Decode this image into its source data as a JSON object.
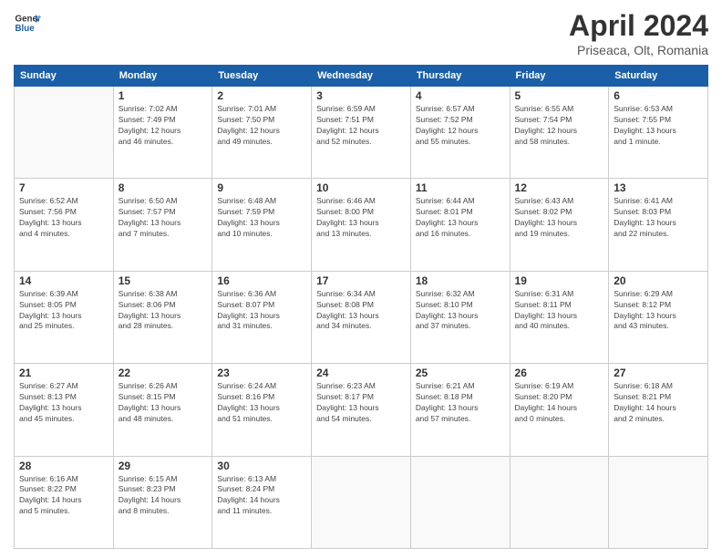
{
  "header": {
    "logo_line1": "General",
    "logo_line2": "Blue",
    "title": "April 2024",
    "subtitle": "Priseaca, Olt, Romania"
  },
  "days_of_week": [
    "Sunday",
    "Monday",
    "Tuesday",
    "Wednesday",
    "Thursday",
    "Friday",
    "Saturday"
  ],
  "weeks": [
    [
      {
        "day": "",
        "info": ""
      },
      {
        "day": "1",
        "info": "Sunrise: 7:02 AM\nSunset: 7:49 PM\nDaylight: 12 hours\nand 46 minutes."
      },
      {
        "day": "2",
        "info": "Sunrise: 7:01 AM\nSunset: 7:50 PM\nDaylight: 12 hours\nand 49 minutes."
      },
      {
        "day": "3",
        "info": "Sunrise: 6:59 AM\nSunset: 7:51 PM\nDaylight: 12 hours\nand 52 minutes."
      },
      {
        "day": "4",
        "info": "Sunrise: 6:57 AM\nSunset: 7:52 PM\nDaylight: 12 hours\nand 55 minutes."
      },
      {
        "day": "5",
        "info": "Sunrise: 6:55 AM\nSunset: 7:54 PM\nDaylight: 12 hours\nand 58 minutes."
      },
      {
        "day": "6",
        "info": "Sunrise: 6:53 AM\nSunset: 7:55 PM\nDaylight: 13 hours\nand 1 minute."
      }
    ],
    [
      {
        "day": "7",
        "info": "Sunrise: 6:52 AM\nSunset: 7:56 PM\nDaylight: 13 hours\nand 4 minutes."
      },
      {
        "day": "8",
        "info": "Sunrise: 6:50 AM\nSunset: 7:57 PM\nDaylight: 13 hours\nand 7 minutes."
      },
      {
        "day": "9",
        "info": "Sunrise: 6:48 AM\nSunset: 7:59 PM\nDaylight: 13 hours\nand 10 minutes."
      },
      {
        "day": "10",
        "info": "Sunrise: 6:46 AM\nSunset: 8:00 PM\nDaylight: 13 hours\nand 13 minutes."
      },
      {
        "day": "11",
        "info": "Sunrise: 6:44 AM\nSunset: 8:01 PM\nDaylight: 13 hours\nand 16 minutes."
      },
      {
        "day": "12",
        "info": "Sunrise: 6:43 AM\nSunset: 8:02 PM\nDaylight: 13 hours\nand 19 minutes."
      },
      {
        "day": "13",
        "info": "Sunrise: 6:41 AM\nSunset: 8:03 PM\nDaylight: 13 hours\nand 22 minutes."
      }
    ],
    [
      {
        "day": "14",
        "info": "Sunrise: 6:39 AM\nSunset: 8:05 PM\nDaylight: 13 hours\nand 25 minutes."
      },
      {
        "day": "15",
        "info": "Sunrise: 6:38 AM\nSunset: 8:06 PM\nDaylight: 13 hours\nand 28 minutes."
      },
      {
        "day": "16",
        "info": "Sunrise: 6:36 AM\nSunset: 8:07 PM\nDaylight: 13 hours\nand 31 minutes."
      },
      {
        "day": "17",
        "info": "Sunrise: 6:34 AM\nSunset: 8:08 PM\nDaylight: 13 hours\nand 34 minutes."
      },
      {
        "day": "18",
        "info": "Sunrise: 6:32 AM\nSunset: 8:10 PM\nDaylight: 13 hours\nand 37 minutes."
      },
      {
        "day": "19",
        "info": "Sunrise: 6:31 AM\nSunset: 8:11 PM\nDaylight: 13 hours\nand 40 minutes."
      },
      {
        "day": "20",
        "info": "Sunrise: 6:29 AM\nSunset: 8:12 PM\nDaylight: 13 hours\nand 43 minutes."
      }
    ],
    [
      {
        "day": "21",
        "info": "Sunrise: 6:27 AM\nSunset: 8:13 PM\nDaylight: 13 hours\nand 45 minutes."
      },
      {
        "day": "22",
        "info": "Sunrise: 6:26 AM\nSunset: 8:15 PM\nDaylight: 13 hours\nand 48 minutes."
      },
      {
        "day": "23",
        "info": "Sunrise: 6:24 AM\nSunset: 8:16 PM\nDaylight: 13 hours\nand 51 minutes."
      },
      {
        "day": "24",
        "info": "Sunrise: 6:23 AM\nSunset: 8:17 PM\nDaylight: 13 hours\nand 54 minutes."
      },
      {
        "day": "25",
        "info": "Sunrise: 6:21 AM\nSunset: 8:18 PM\nDaylight: 13 hours\nand 57 minutes."
      },
      {
        "day": "26",
        "info": "Sunrise: 6:19 AM\nSunset: 8:20 PM\nDaylight: 14 hours\nand 0 minutes."
      },
      {
        "day": "27",
        "info": "Sunrise: 6:18 AM\nSunset: 8:21 PM\nDaylight: 14 hours\nand 2 minutes."
      }
    ],
    [
      {
        "day": "28",
        "info": "Sunrise: 6:16 AM\nSunset: 8:22 PM\nDaylight: 14 hours\nand 5 minutes."
      },
      {
        "day": "29",
        "info": "Sunrise: 6:15 AM\nSunset: 8:23 PM\nDaylight: 14 hours\nand 8 minutes."
      },
      {
        "day": "30",
        "info": "Sunrise: 6:13 AM\nSunset: 8:24 PM\nDaylight: 14 hours\nand 11 minutes."
      },
      {
        "day": "",
        "info": ""
      },
      {
        "day": "",
        "info": ""
      },
      {
        "day": "",
        "info": ""
      },
      {
        "day": "",
        "info": ""
      }
    ]
  ]
}
